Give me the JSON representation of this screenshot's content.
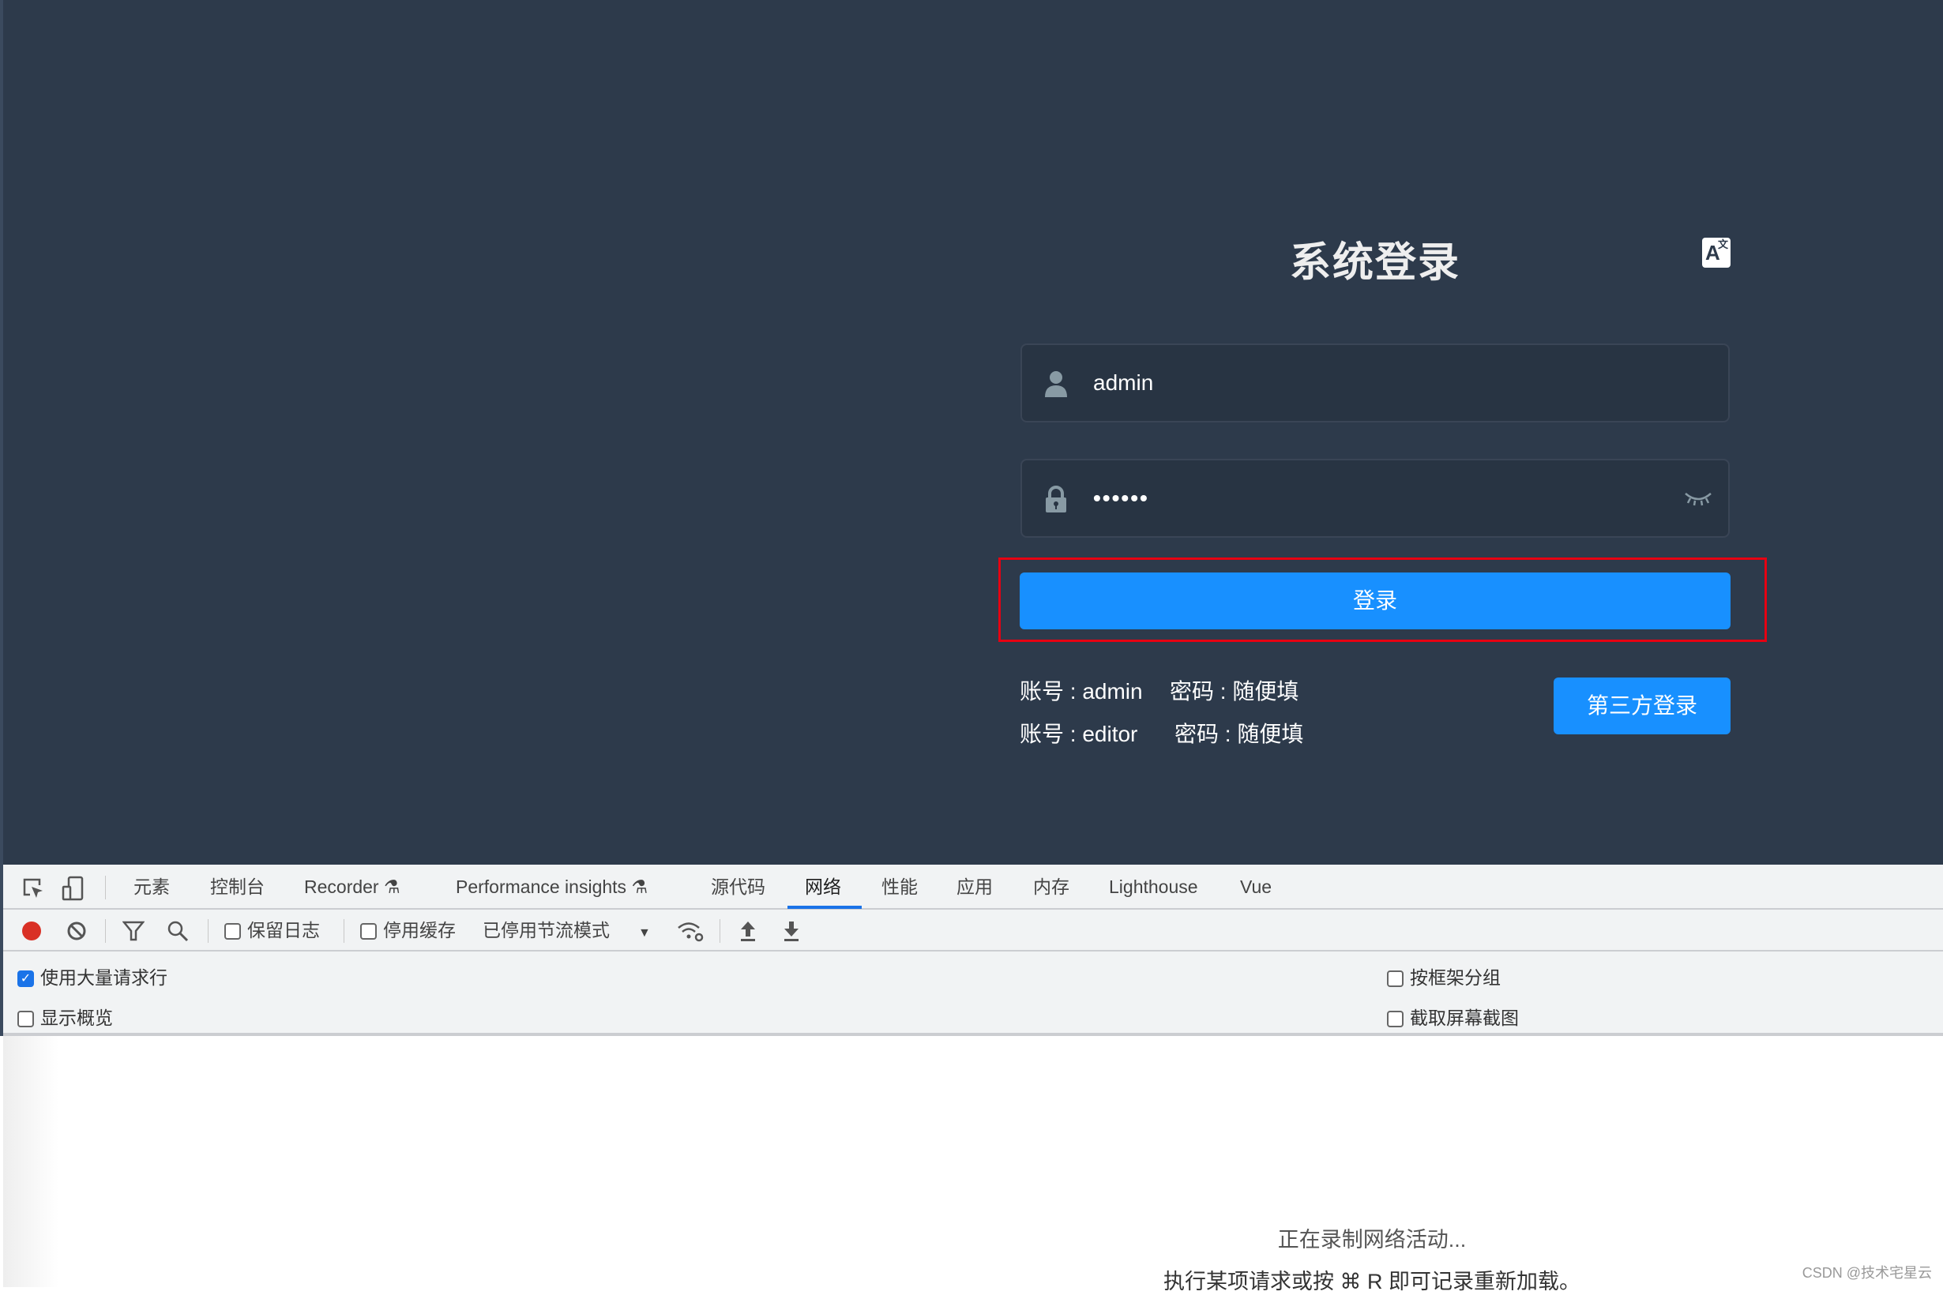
{
  "login": {
    "title": "系统登录",
    "lang_icon": "translate-icon",
    "lang_label": "A",
    "lang_sup": "文",
    "username_value": "admin",
    "password_value": "••••••",
    "login_button": "登录",
    "hints": [
      {
        "account": "账号 : admin",
        "password": "密码 : 随便填"
      },
      {
        "account": "账号 : editor",
        "password": "密码 : 随便填"
      }
    ],
    "third_party_button": "第三方登录",
    "accent_color": "#1890ff",
    "highlight_color": "#e60012"
  },
  "devtools": {
    "tabs": [
      "元素",
      "控制台",
      "Recorder",
      "Performance insights",
      "源代码",
      "网络",
      "性能",
      "应用",
      "内存",
      "Lighthouse",
      "Vue"
    ],
    "active_tab": "网络",
    "toolbar": {
      "preserve_log": "保留日志",
      "disable_cache": "停用缓存",
      "throttling": "已停用节流模式"
    },
    "settings": {
      "big_request_rows": "使用大量请求行",
      "show_overview": "显示概览",
      "group_by_frame": "按框架分组",
      "capture_screenshots": "截取屏幕截图"
    },
    "empty": {
      "line1": "正在录制网络活动...",
      "line2": "执行某项请求或按 ⌘ R 即可记录重新加载。"
    }
  },
  "watermark": "CSDN @技术宅星云"
}
